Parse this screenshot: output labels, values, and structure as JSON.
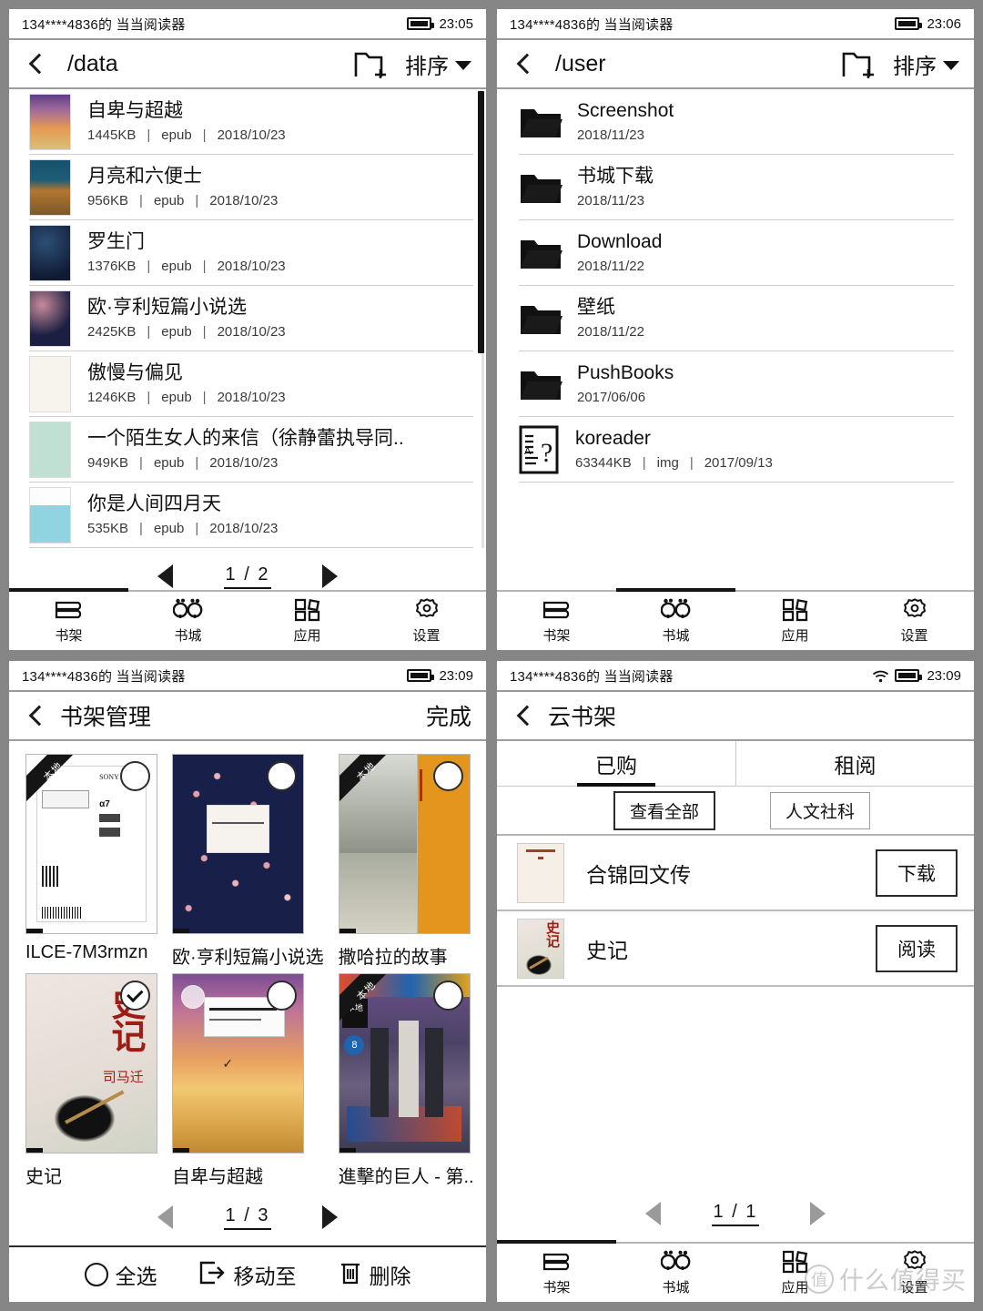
{
  "panels": {
    "file_data": {
      "status": {
        "user": "134****4836的  当当阅读器",
        "time": "23:05",
        "wifi": false
      },
      "title": "/data",
      "sort_label": "排序",
      "files": [
        {
          "name": "自卑与超越",
          "size": "1445KB",
          "type": "epub",
          "date": "2018/10/23"
        },
        {
          "name": "月亮和六便士",
          "size": "956KB",
          "type": "epub",
          "date": "2018/10/23"
        },
        {
          "name": "罗生门",
          "size": "1376KB",
          "type": "epub",
          "date": "2018/10/23"
        },
        {
          "name": "欧·亨利短篇小说选",
          "size": "2425KB",
          "type": "epub",
          "date": "2018/10/23"
        },
        {
          "name": "傲慢与偏见",
          "size": "1246KB",
          "type": "epub",
          "date": "2018/10/23"
        },
        {
          "name": "一个陌生女人的来信（徐静蕾执导同..",
          "size": "949KB",
          "type": "epub",
          "date": "2018/10/23"
        },
        {
          "name": "你是人间四月天",
          "size": "535KB",
          "type": "epub",
          "date": "2018/10/23"
        }
      ],
      "pager": {
        "current": "1",
        "total": "2",
        "text": "1 / 2"
      },
      "nav": [
        {
          "label": "书架",
          "icon": "bookshelf-icon"
        },
        {
          "label": "书城",
          "icon": "bookstore-icon"
        },
        {
          "label": "应用",
          "icon": "apps-icon"
        },
        {
          "label": "设置",
          "icon": "settings-gear-icon"
        }
      ],
      "nav_active_index": 0
    },
    "file_user": {
      "status": {
        "user": "134****4836的  当当阅读器",
        "time": "23:06",
        "wifi": false
      },
      "title": "/user",
      "sort_label": "排序",
      "files": [
        {
          "name": "Screenshot",
          "kind": "folder",
          "date": "2018/11/23"
        },
        {
          "name": "书城下载",
          "kind": "folder",
          "date": "2018/11/23"
        },
        {
          "name": "Download",
          "kind": "folder",
          "date": "2018/11/22"
        },
        {
          "name": "壁纸",
          "kind": "folder",
          "date": "2018/11/22"
        },
        {
          "name": "PushBooks",
          "kind": "folder",
          "date": "2017/06/06"
        },
        {
          "name": "koreader",
          "kind": "file",
          "size": "63344KB",
          "type": "img",
          "date": "2017/09/13"
        }
      ],
      "nav": [
        {
          "label": "书架",
          "icon": "bookshelf-icon"
        },
        {
          "label": "书城",
          "icon": "bookstore-icon"
        },
        {
          "label": "应用",
          "icon": "apps-icon"
        },
        {
          "label": "设置",
          "icon": "settings-gear-icon"
        }
      ],
      "nav_active_index": 1
    },
    "shelf_manage": {
      "status": {
        "user": "134****4836的  当当阅读器",
        "time": "23:09",
        "wifi": false
      },
      "title": "书架管理",
      "done_label": "完成",
      "books": [
        {
          "title": "ILCE-7M3rmzn",
          "badge": "本地",
          "selected": false,
          "art": "manual"
        },
        {
          "title": "欧·亨利短篇小说选",
          "badge": "",
          "selected": false,
          "art": "blossom"
        },
        {
          "title": "撒哈拉的故事",
          "badge": "本地",
          "selected": false,
          "art": "sahara"
        },
        {
          "title": "史记",
          "badge": "",
          "selected": true,
          "art": "shiji"
        },
        {
          "title": "自卑与超越",
          "badge": "",
          "selected": false,
          "art": "sunset"
        },
        {
          "title": "進擊的巨人 - 第..",
          "badge": "本地",
          "selected": false,
          "art": "titan"
        }
      ],
      "pager": {
        "current": "1",
        "total": "3",
        "text": "1 / 3"
      },
      "actions": [
        {
          "label": "全选",
          "icon": "circle-icon"
        },
        {
          "label": "移动至",
          "icon": "move-to-icon"
        },
        {
          "label": "删除",
          "icon": "trash-icon"
        }
      ]
    },
    "cloud_shelf": {
      "status": {
        "user": "134****4836的  当当阅读器",
        "time": "23:09",
        "wifi": true
      },
      "title": "云书架",
      "tabs": [
        {
          "label": "已购",
          "active": true
        },
        {
          "label": "租阅",
          "active": false
        }
      ],
      "filters": [
        {
          "label": "查看全部",
          "selected": true
        },
        {
          "label": "人文社科",
          "selected": false
        }
      ],
      "books": [
        {
          "title": "合锦回文传",
          "action": "下载",
          "art": "hejin"
        },
        {
          "title": "史记",
          "action": "阅读",
          "art": "shiji"
        }
      ],
      "pager": {
        "current": "1",
        "total": "1",
        "text": "1 / 1"
      },
      "nav": [
        {
          "label": "书架",
          "icon": "bookshelf-icon"
        },
        {
          "label": "书城",
          "icon": "bookstore-icon"
        },
        {
          "label": "应用",
          "icon": "apps-icon"
        },
        {
          "label": "设置",
          "icon": "settings-gear-icon"
        }
      ],
      "nav_active_index": 0
    }
  },
  "watermark": {
    "badge": "值",
    "text": "什么值得买"
  },
  "colors": {
    "background": "#868686",
    "screen": "#ffffff",
    "text": "#111111",
    "divider": "#cfcfcf",
    "accent": "#151515"
  }
}
